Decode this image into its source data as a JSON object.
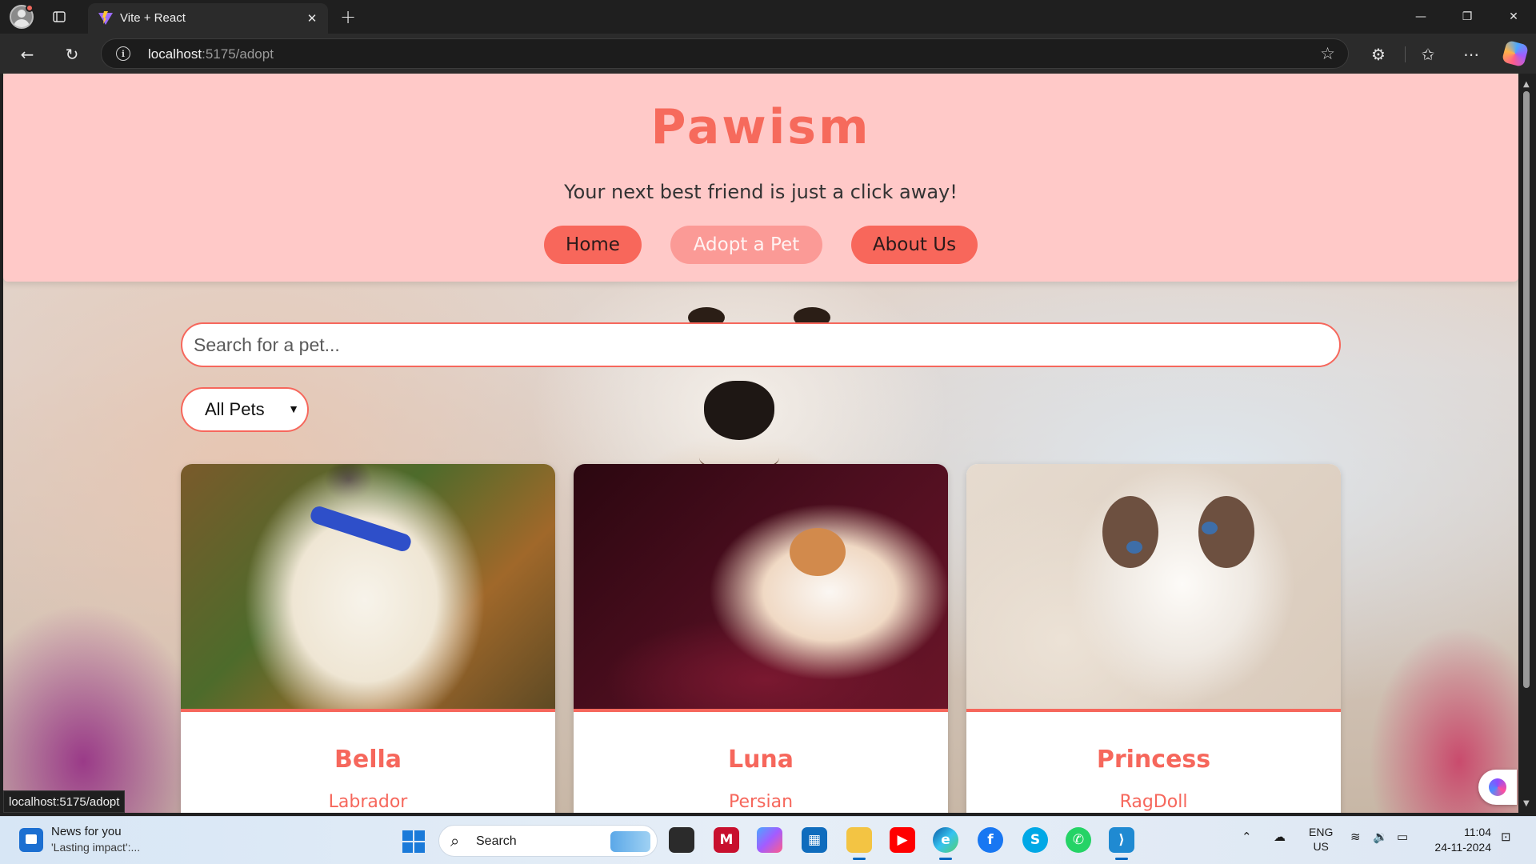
{
  "browser": {
    "tab_title": "Vite + React",
    "url_host": "localhost",
    "url_rest": ":5175/adopt",
    "status_url": "localhost:5175/adopt"
  },
  "site": {
    "brand": "Pawism",
    "tagline": "Your next best friend is just a click away!",
    "nav": [
      {
        "label": "Home",
        "active": false
      },
      {
        "label": "Adopt a Pet",
        "active": true
      },
      {
        "label": "About Us",
        "active": false
      }
    ],
    "search_placeholder": "Search for a pet...",
    "filter_selected": "All Pets",
    "accent_color": "#f6675c",
    "header_color": "#ffc9c8"
  },
  "pets": [
    {
      "name": "Bella",
      "breed": "Labrador",
      "image": "labrador-puppy"
    },
    {
      "name": "Luna",
      "breed": "Persian",
      "image": "persian-kitten"
    },
    {
      "name": "Princess",
      "breed": "RagDoll",
      "image": "ragdoll-cat"
    }
  ],
  "taskbar": {
    "news_title": "News for you",
    "news_subtitle": "'Lasting impact':...",
    "search_label": "Search",
    "lang_line1": "ENG",
    "lang_line2": "US",
    "time": "11:04",
    "date": "24-11-2024",
    "apps": [
      "task-view",
      "mcafee",
      "copilot",
      "microsoft-store",
      "file-explorer",
      "youtube",
      "edge",
      "facebook",
      "skype",
      "whatsapp",
      "vscode"
    ]
  }
}
